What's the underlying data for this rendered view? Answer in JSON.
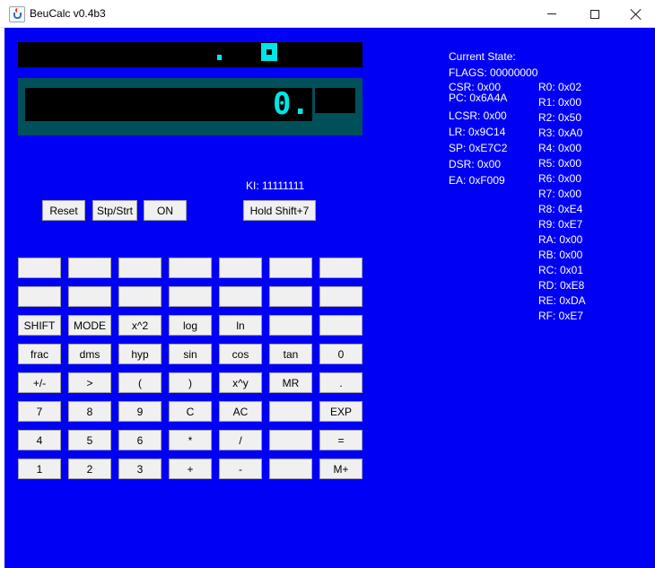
{
  "window": {
    "title": "BeuCalc v0.4b3"
  },
  "display": {
    "main_value": "0."
  },
  "ki_label": "KI: 11111111",
  "controls": {
    "reset": "Reset",
    "stop_start": "Stp/Strt",
    "on": "ON",
    "hold_shift": "Hold Shift+7"
  },
  "keypad": {
    "row1": [
      "",
      "",
      "",
      "",
      "",
      "",
      ""
    ],
    "row2": [
      "",
      "",
      "",
      "",
      "",
      "",
      ""
    ],
    "row3": [
      "SHIFT",
      "MODE",
      "x^2",
      "log",
      "ln",
      "",
      ""
    ],
    "row4": [
      "frac",
      "dms",
      "hyp",
      "sin",
      "cos",
      "tan",
      "0"
    ],
    "row5": [
      "+/-",
      ">",
      "(",
      ")",
      "x^y",
      "MR",
      "."
    ],
    "row6": [
      "7",
      "8",
      "9",
      "C",
      "AC",
      "",
      "EXP"
    ],
    "row7": [
      "4",
      "5",
      "6",
      "*",
      "/",
      "",
      "="
    ],
    "row8": [
      "1",
      "2",
      "3",
      "+",
      "-",
      "",
      "M+"
    ]
  },
  "state": {
    "header": "Current State:",
    "flags": "FLAGS: 00000000",
    "csr": "CSR: 0x00",
    "pc": "PC: 0x6A4A",
    "lcsr": "LCSR: 0x00",
    "lr": "LR: 0x9C14",
    "sp": "SP: 0xE7C2",
    "dsr": "DSR: 0x00",
    "ea": "EA: 0xF009"
  },
  "registers": [
    "R0: 0x02",
    "R1: 0x00",
    "R2: 0x50",
    "R3: 0xA0",
    "R4: 0x00",
    "R5: 0x00",
    "R6: 0x00",
    "R7: 0x00",
    "R8: 0xE4",
    "R9: 0xE7",
    "RA: 0x00",
    "RB: 0x00",
    "RC: 0x01",
    "RD: 0xE8",
    "RE: 0xDA",
    "RF: 0xE7"
  ],
  "colors": {
    "background": "#0000f5",
    "lcd_glyph": "#00e6e6",
    "lcd_frame": "#00505a"
  }
}
